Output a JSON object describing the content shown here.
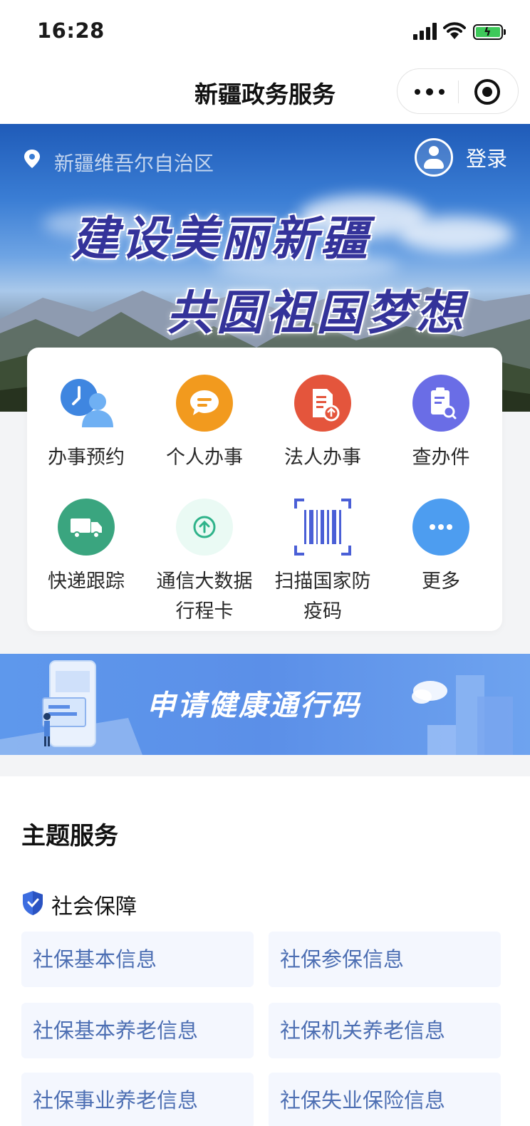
{
  "status_bar": {
    "time": "16:28"
  },
  "navbar": {
    "title": "新疆政务服务"
  },
  "banner": {
    "location": "新疆维吾尔自治区",
    "login": "登录",
    "slogan_line1": "建设美丽新疆",
    "slogan_line2": "共圆祖国梦想"
  },
  "quick_services": [
    {
      "label": "办事预约",
      "icon": "appointment-icon",
      "color": "#3f86e0"
    },
    {
      "label": "个人办事",
      "icon": "chat-bubble-icon",
      "color": "#f29a1e"
    },
    {
      "label": "法人办事",
      "icon": "document-upload-icon",
      "color": "#e4553c"
    },
    {
      "label": "查办件",
      "icon": "clipboard-search-icon",
      "color": "#6a6de6"
    },
    {
      "label": "快递跟踪",
      "icon": "delivery-truck-icon",
      "color": "#3aa57f"
    },
    {
      "label": "通信大数据\n行程卡",
      "icon": "arrow-up-circle-icon",
      "color": "#2fb38a"
    },
    {
      "label": "扫描国家防\n疫码",
      "icon": "barcode-scan-icon",
      "color": "#4a5fd6"
    },
    {
      "label": "更多",
      "icon": "more-dots-icon",
      "color": "#4d9df0"
    }
  ],
  "health_banner": {
    "text": "申请健康通行码"
  },
  "theme_services": {
    "title": "主题服务",
    "category": "社会保障",
    "items": [
      "社保基本信息",
      "社保参保信息",
      "社保基本养老信息",
      "社保机关养老信息",
      "社保事业养老信息",
      "社保失业保险信息"
    ]
  }
}
